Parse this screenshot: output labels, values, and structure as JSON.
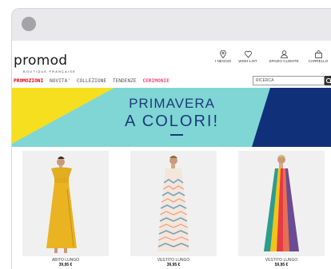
{
  "brand": {
    "name": "promod",
    "tagline": "BOUTIQUE FRANÇAISE"
  },
  "utility": [
    {
      "label": "I NEGOZI",
      "icon": "location-pin-icon"
    },
    {
      "label": "WISH-LIST",
      "icon": "heart-icon"
    },
    {
      "label": "SPAZIO CLIENTE",
      "icon": "user-icon"
    },
    {
      "label": "CARRELLO",
      "icon": "shopping-bag-icon"
    }
  ],
  "nav": {
    "promozioni": "PROMOZIONI",
    "novita": "NOVITA'",
    "collezione": "COLLEZIONE",
    "tendenze": "TENDENZE",
    "cerimonie": "CERIMONIE"
  },
  "search": {
    "placeholder": "RICERCA"
  },
  "banner": {
    "line1": "PRIMAVERA",
    "line2": "A COLORI!",
    "colors": {
      "yellow": "#f6df1f",
      "teal": "#7fd6d4",
      "navy": "#10317a"
    }
  },
  "products": [
    {
      "name": "ABITO LUNGO",
      "price": "39,95 €"
    },
    {
      "name": "VESTITO LUNGO",
      "price": "39,95 €"
    },
    {
      "name": "VESTITO LUNGO",
      "price": "59,95 €"
    }
  ],
  "colors": {
    "promo": "#e30613",
    "ceremony": "#e94e7a",
    "text": "#1a1a1a"
  }
}
